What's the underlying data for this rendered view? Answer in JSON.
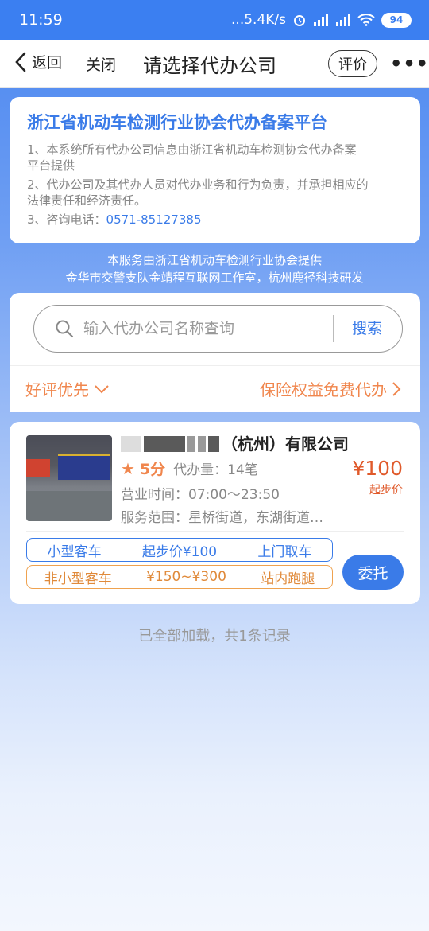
{
  "status_bar": {
    "time": "11:59",
    "net_speed": "...5.4K/s",
    "battery": "94"
  },
  "navbar": {
    "back_label": "返回",
    "close_label": "关闭",
    "title": "请选择代办公司",
    "rate_label": "评价",
    "more_label": "•••"
  },
  "notice": {
    "title": "浙江省机动车检测行业协会代办备案平台",
    "line1a": "1、本系统所有代办公司信息由浙江省机动车检测协会代办备案",
    "line1b": "平台提供",
    "line2a": "2、代办公司及其代办人员对代办业务和行为负责，并承担相应的",
    "line2b": "法律责任和经济责任。",
    "line3_prefix": "3、咨询电话：",
    "phone": "0571-85127385"
  },
  "provider": {
    "line1": "本服务由浙江省机动车检测行业协会提供",
    "line2": "金华市交警支队金靖程互联网工作室，杭州鹿径科技研发"
  },
  "search": {
    "placeholder": "输入代办公司名称查询",
    "button": "搜索"
  },
  "filters": {
    "sort_label": "好评优先",
    "insurance_label": "保险权益免费代办"
  },
  "company": {
    "name_suffix": "（杭州）有限公司",
    "score": "5分",
    "orders": "代办量：14笔",
    "hours": "营业时间：07:00～23:50",
    "service_range": "服务范围：星桥街道，东湖街道…",
    "price": "¥100",
    "price_note": "起步价",
    "tags_small": [
      "小型客车",
      "起步价¥100",
      "上门取车"
    ],
    "tags_other": [
      "非小型客车",
      "¥150~¥300",
      "站内跑腿"
    ],
    "entrust_label": "委托"
  },
  "footer": {
    "text": "已全部加载，共1条记录"
  },
  "colors": {
    "accent": "#3a7be8",
    "orange": "#f0864d",
    "price": "#e05a2b"
  }
}
